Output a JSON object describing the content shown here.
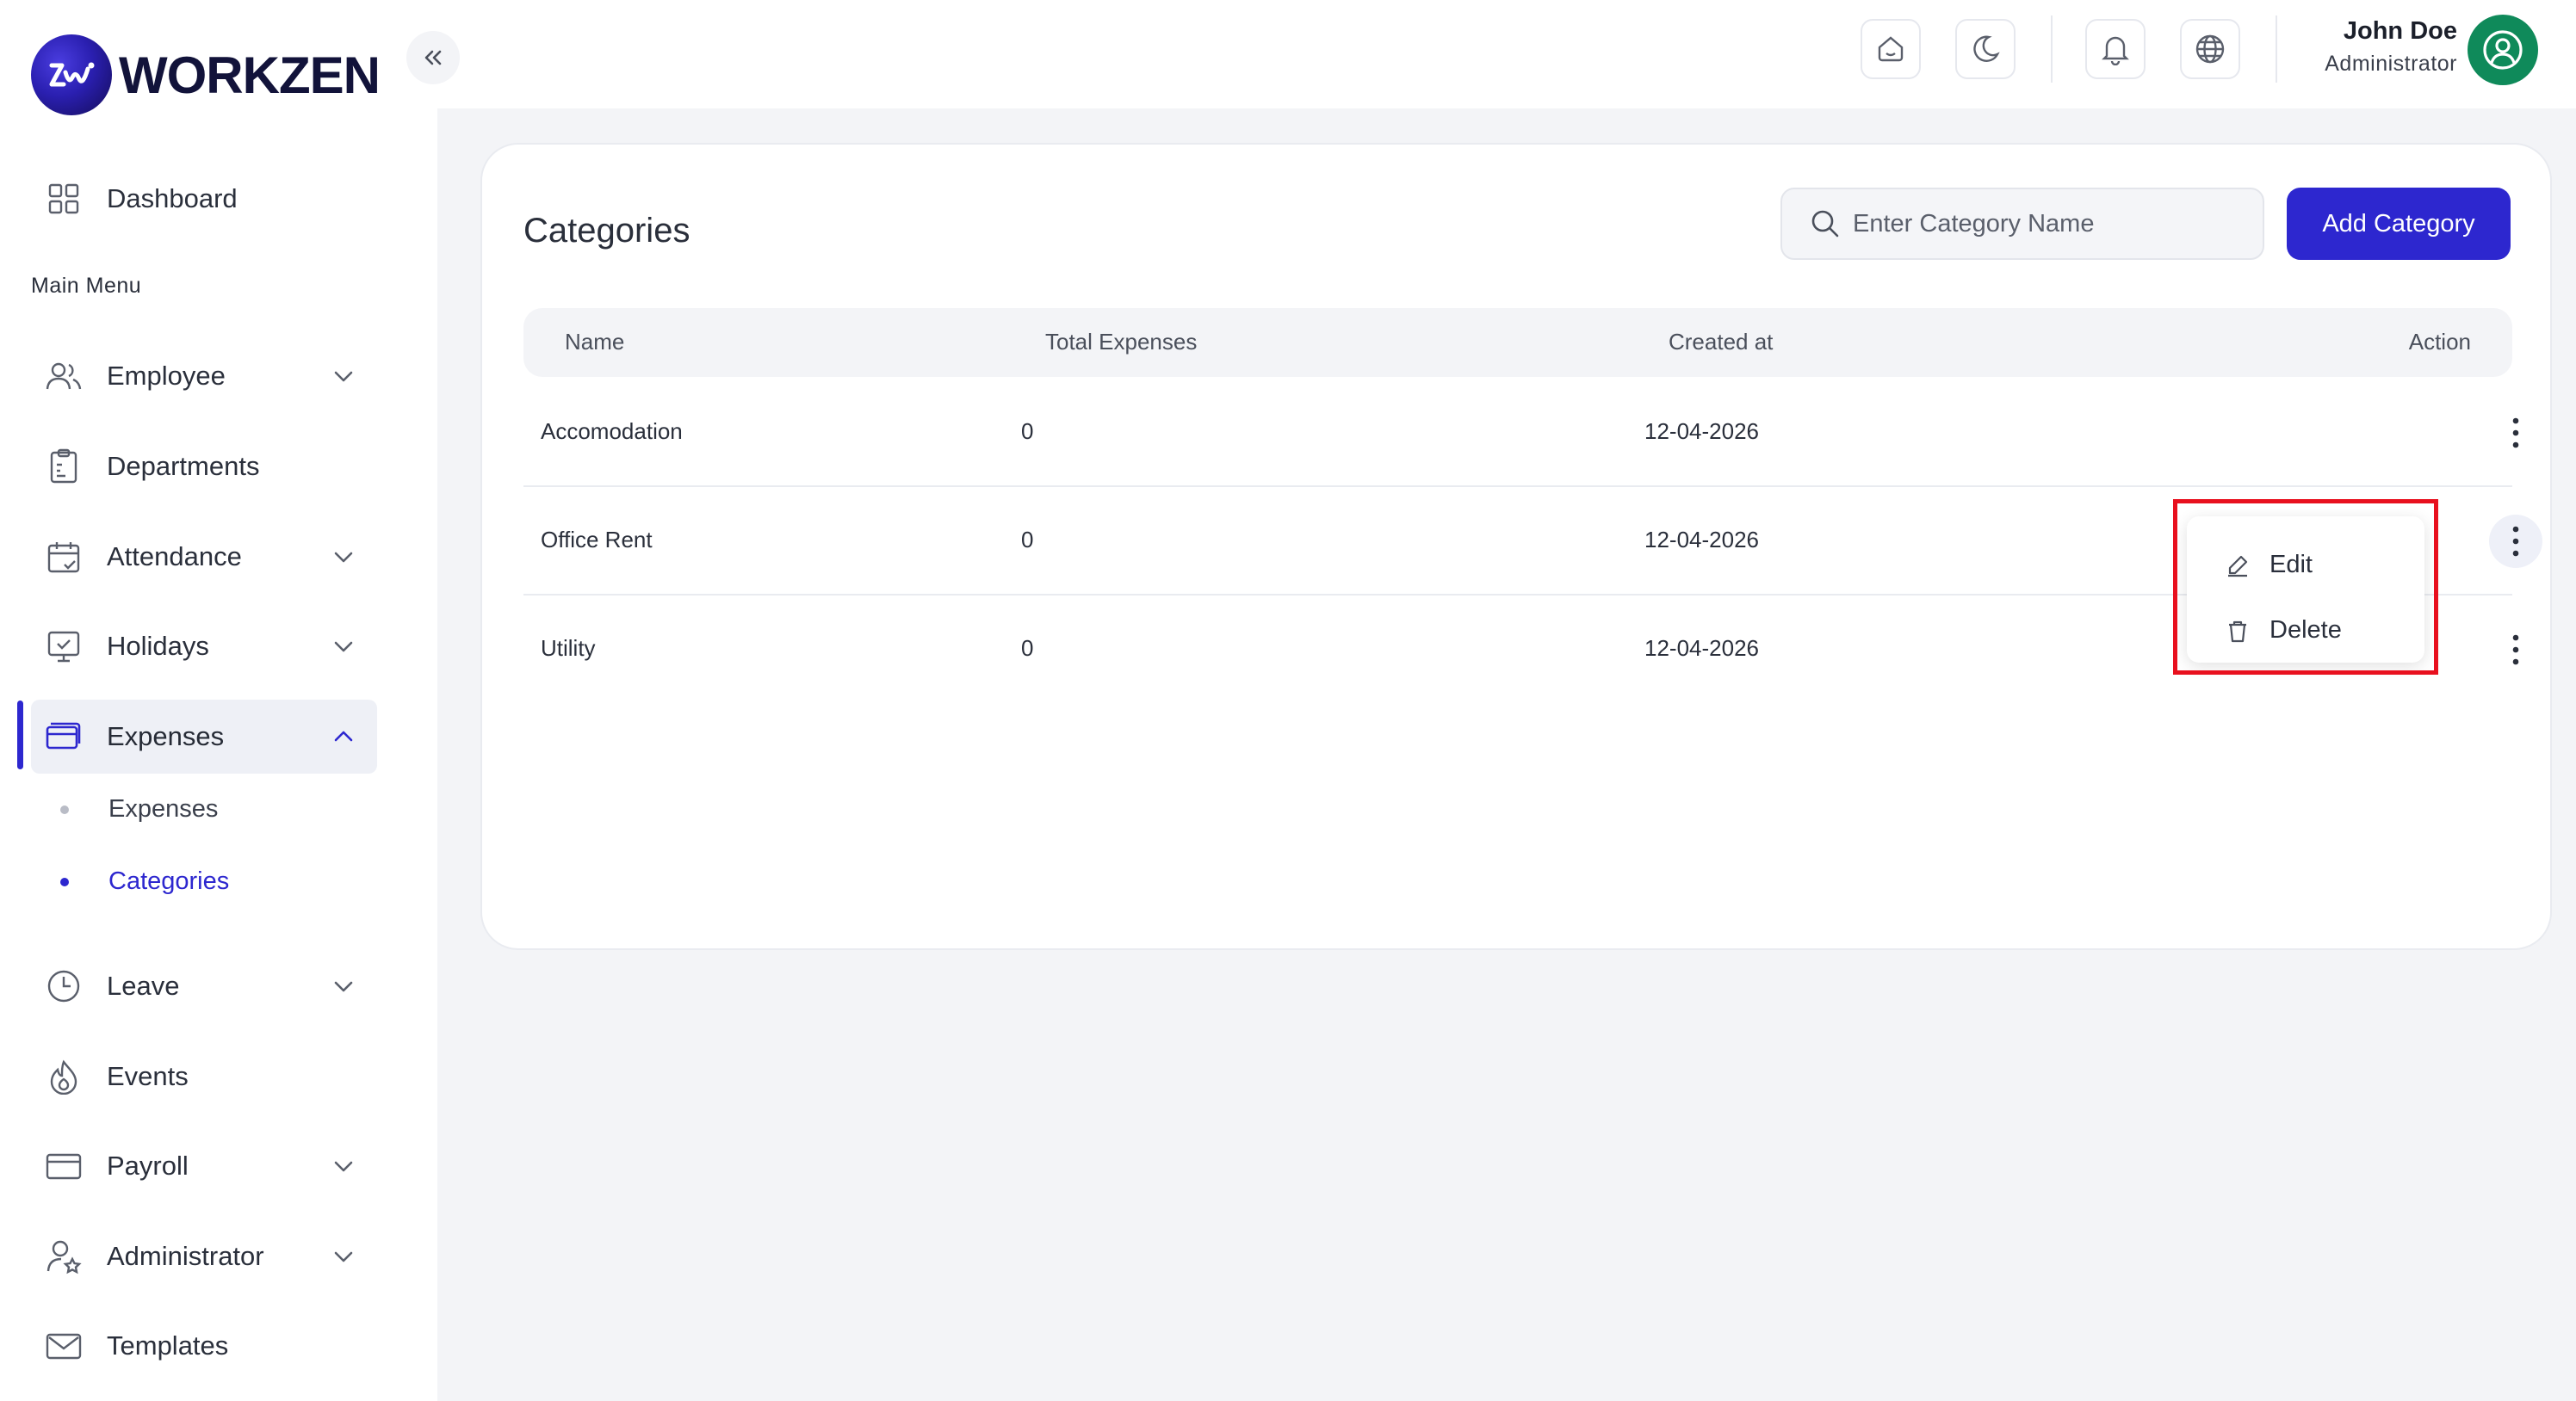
{
  "brand": {
    "name": "WORKZEN"
  },
  "sidebar": {
    "dashboard": "Dashboard",
    "section_title": "Main Menu",
    "items": [
      {
        "label": "Employee",
        "icon": "users-icon",
        "has_chevron": true
      },
      {
        "label": "Departments",
        "icon": "clipboard-icon",
        "has_chevron": false
      },
      {
        "label": "Attendance",
        "icon": "calendar-icon",
        "has_chevron": true
      },
      {
        "label": "Holidays",
        "icon": "monitor-check-icon",
        "has_chevron": true
      },
      {
        "label": "Expenses",
        "icon": "wallet-icon",
        "has_chevron": true,
        "expanded": true
      },
      {
        "label": "Leave",
        "icon": "clock-icon",
        "has_chevron": true
      },
      {
        "label": "Events",
        "icon": "flame-icon",
        "has_chevron": false
      },
      {
        "label": "Payroll",
        "icon": "credit-card-icon",
        "has_chevron": true
      },
      {
        "label": "Administrator",
        "icon": "user-star-icon",
        "has_chevron": true
      },
      {
        "label": "Templates",
        "icon": "mail-icon",
        "has_chevron": false
      }
    ],
    "expenses_sub": [
      {
        "label": "Expenses",
        "current": false
      },
      {
        "label": "Categories",
        "current": true
      }
    ]
  },
  "header": {
    "user_name": "John Doe",
    "user_role": "Administrator",
    "icons": [
      "home-icon",
      "moon-icon",
      "bell-icon",
      "globe-icon"
    ]
  },
  "page": {
    "title": "Categories",
    "search_placeholder": "Enter Category Name",
    "add_button": "Add Category",
    "columns": [
      "Name",
      "Total Expenses",
      "Created at",
      "Action"
    ],
    "rows": [
      {
        "name": "Accomodation",
        "total": "0",
        "created": "12-04-2026"
      },
      {
        "name": "Office Rent",
        "total": "0",
        "created": "12-04-2026"
      },
      {
        "name": "Utility",
        "total": "0",
        "created": "12-04-2026"
      }
    ],
    "menu": {
      "edit": "Edit",
      "delete": "Delete"
    }
  },
  "colors": {
    "primary": "#2d27cf",
    "avatar": "#0f8a5a",
    "highlight": "#e8101e",
    "background": "#f3f4f7"
  }
}
